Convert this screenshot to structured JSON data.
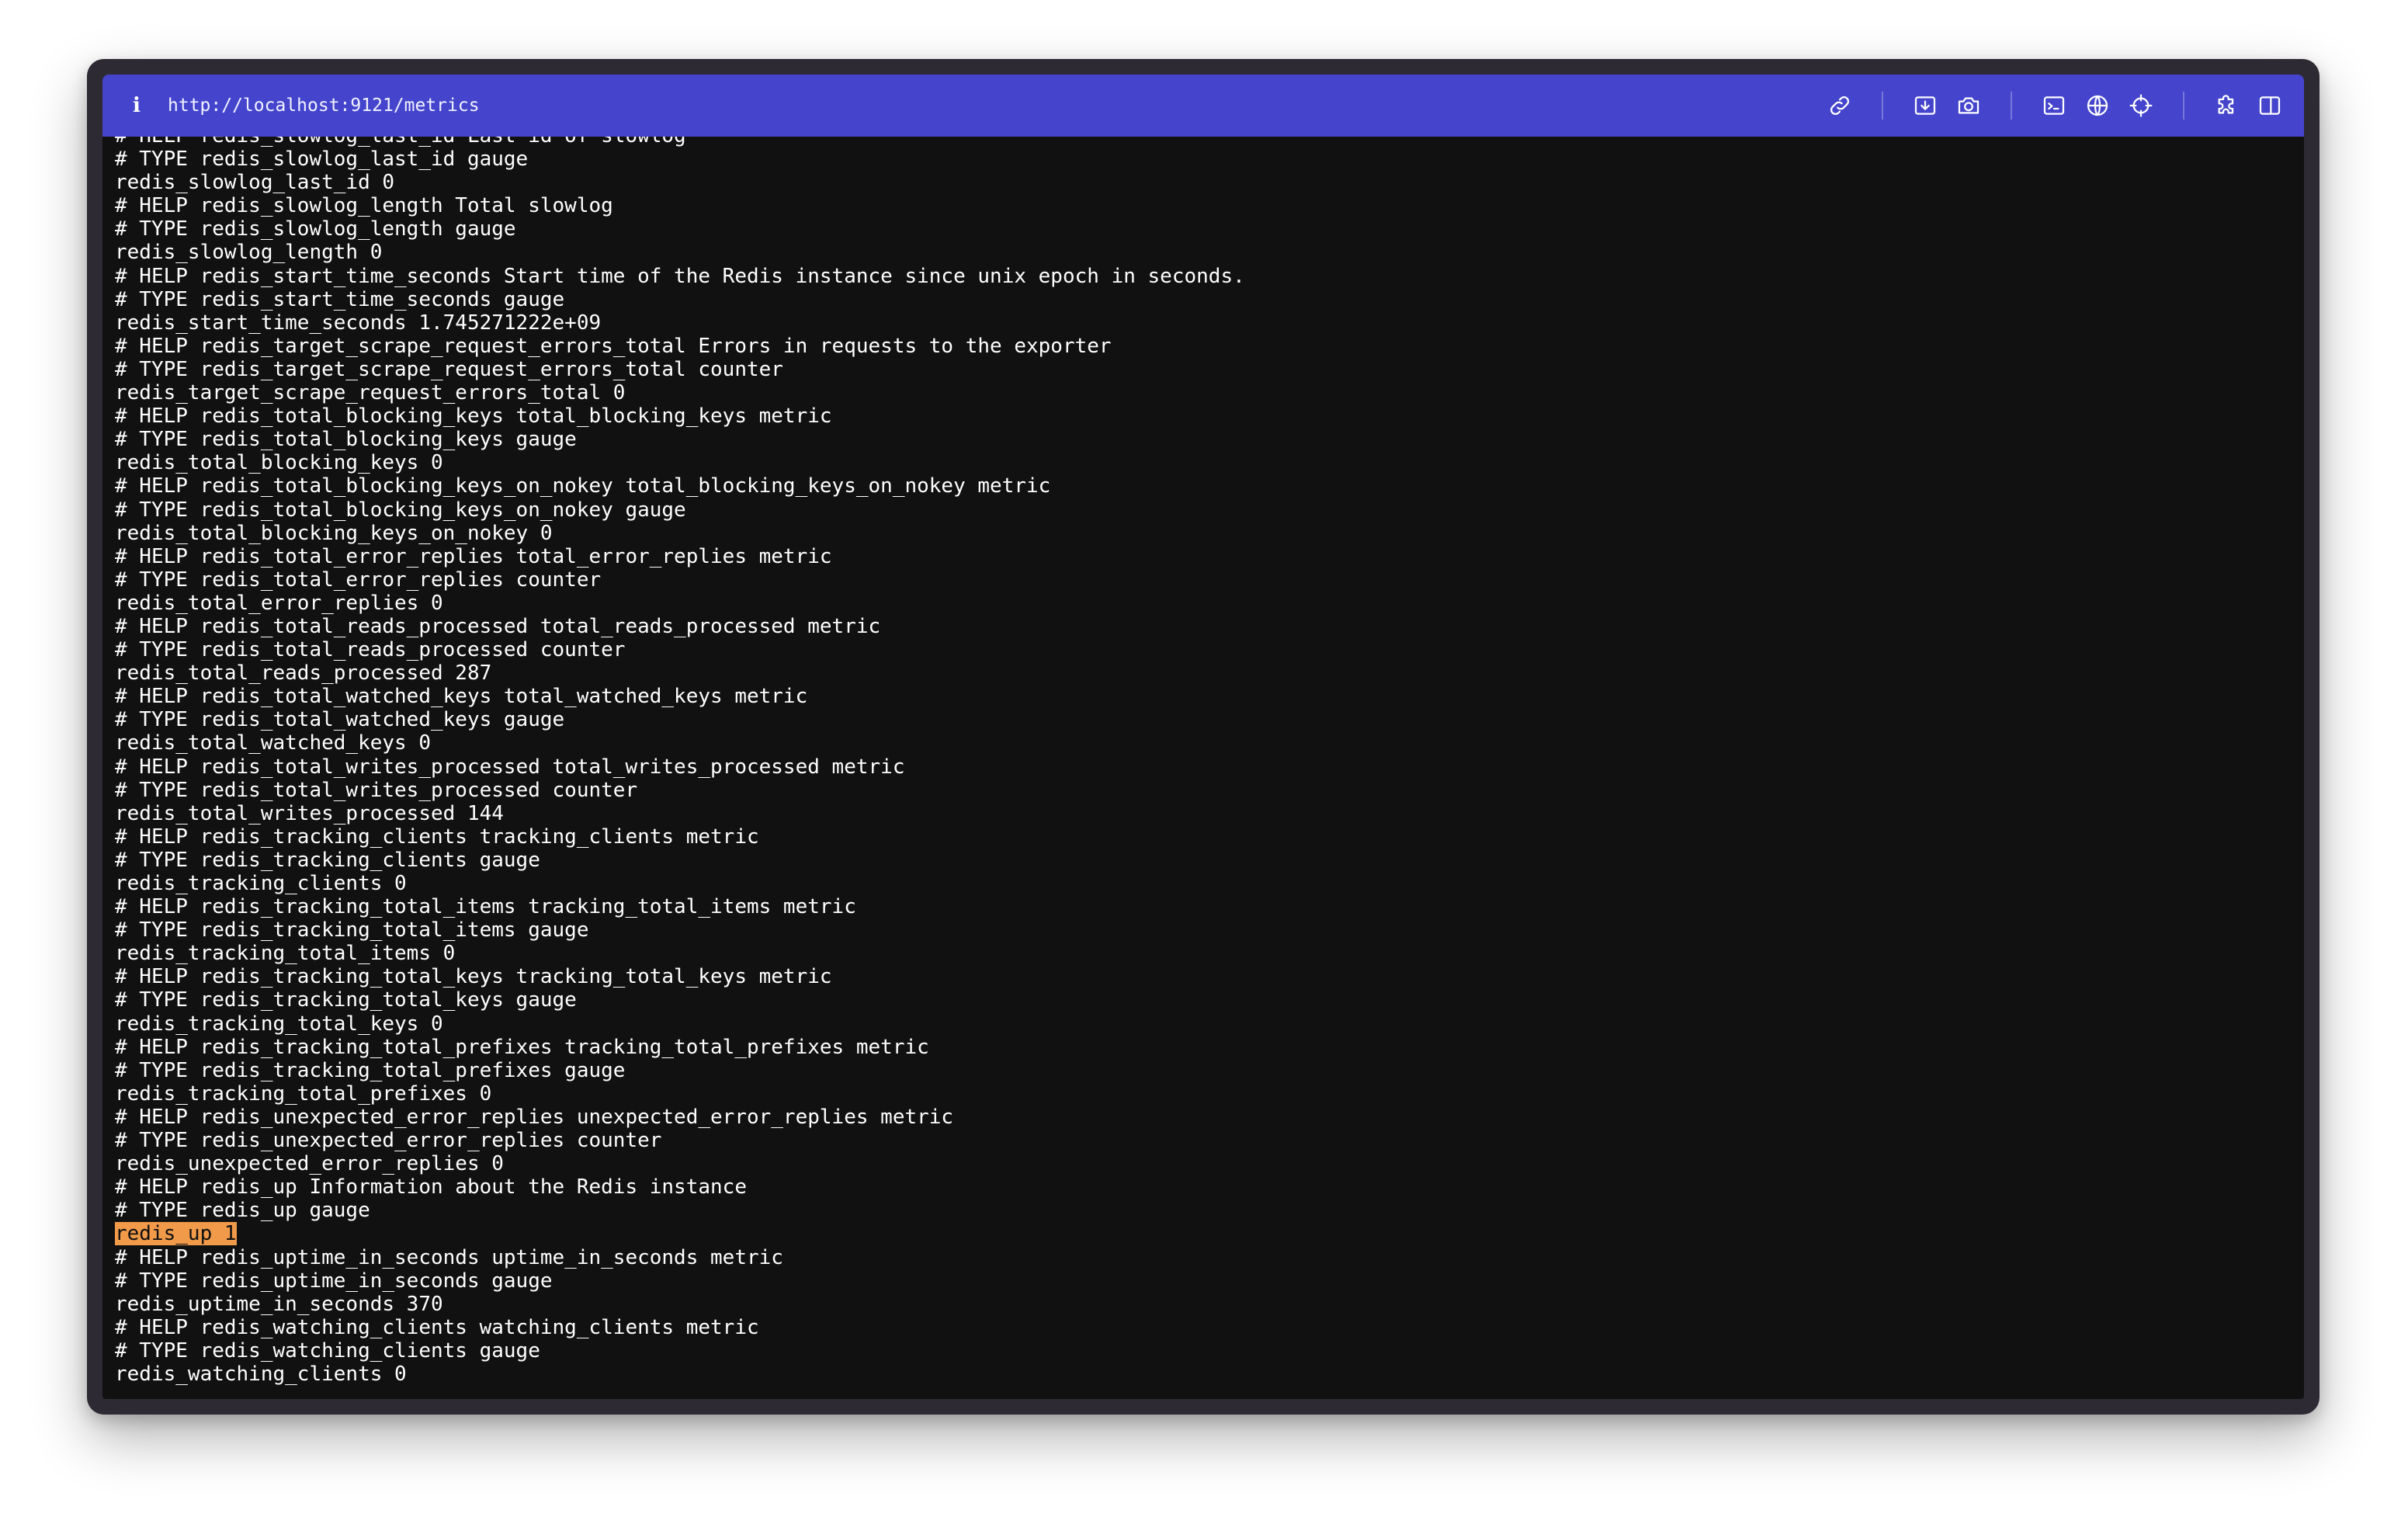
{
  "browser": {
    "url": "http://localhost:9121/metrics",
    "info_icon": "i",
    "toolbar_icons": [
      "link-icon",
      "download-icon",
      "camera-icon",
      "terminal-icon",
      "globe-icon",
      "crosshair-icon",
      "extension-icon",
      "split-view-icon"
    ],
    "accent_color": "#4445cc"
  },
  "metrics": {
    "highlight_color": "#f09a4a",
    "lines": [
      "# HELP redis_slowlog_last_id Last id of slowlog",
      "# TYPE redis_slowlog_last_id gauge",
      "redis_slowlog_last_id 0",
      "# HELP redis_slowlog_length Total slowlog",
      "# TYPE redis_slowlog_length gauge",
      "redis_slowlog_length 0",
      "# HELP redis_start_time_seconds Start time of the Redis instance since unix epoch in seconds.",
      "# TYPE redis_start_time_seconds gauge",
      "redis_start_time_seconds 1.745271222e+09",
      "# HELP redis_target_scrape_request_errors_total Errors in requests to the exporter",
      "# TYPE redis_target_scrape_request_errors_total counter",
      "redis_target_scrape_request_errors_total 0",
      "# HELP redis_total_blocking_keys total_blocking_keys metric",
      "# TYPE redis_total_blocking_keys gauge",
      "redis_total_blocking_keys 0",
      "# HELP redis_total_blocking_keys_on_nokey total_blocking_keys_on_nokey metric",
      "# TYPE redis_total_blocking_keys_on_nokey gauge",
      "redis_total_blocking_keys_on_nokey 0",
      "# HELP redis_total_error_replies total_error_replies metric",
      "# TYPE redis_total_error_replies counter",
      "redis_total_error_replies 0",
      "# HELP redis_total_reads_processed total_reads_processed metric",
      "# TYPE redis_total_reads_processed counter",
      "redis_total_reads_processed 287",
      "# HELP redis_total_watched_keys total_watched_keys metric",
      "# TYPE redis_total_watched_keys gauge",
      "redis_total_watched_keys 0",
      "# HELP redis_total_writes_processed total_writes_processed metric",
      "# TYPE redis_total_writes_processed counter",
      "redis_total_writes_processed 144",
      "# HELP redis_tracking_clients tracking_clients metric",
      "# TYPE redis_tracking_clients gauge",
      "redis_tracking_clients 0",
      "# HELP redis_tracking_total_items tracking_total_items metric",
      "# TYPE redis_tracking_total_items gauge",
      "redis_tracking_total_items 0",
      "# HELP redis_tracking_total_keys tracking_total_keys metric",
      "# TYPE redis_tracking_total_keys gauge",
      "redis_tracking_total_keys 0",
      "# HELP redis_tracking_total_prefixes tracking_total_prefixes metric",
      "# TYPE redis_tracking_total_prefixes gauge",
      "redis_tracking_total_prefixes 0",
      "# HELP redis_unexpected_error_replies unexpected_error_replies metric",
      "# TYPE redis_unexpected_error_replies counter",
      "redis_unexpected_error_replies 0",
      "# HELP redis_up Information about the Redis instance",
      "# TYPE redis_up gauge",
      "redis_up 1",
      "# HELP redis_uptime_in_seconds uptime_in_seconds metric",
      "# TYPE redis_uptime_in_seconds gauge",
      "redis_uptime_in_seconds 370",
      "# HELP redis_watching_clients watching_clients metric",
      "# TYPE redis_watching_clients gauge",
      "redis_watching_clients 0"
    ],
    "highlighted_line": "redis_up 1"
  }
}
